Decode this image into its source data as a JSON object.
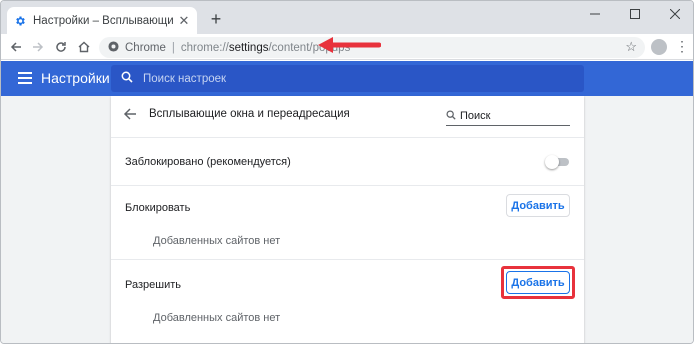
{
  "tab": {
    "title": "Настройки – Всплывающие окна и переадресация",
    "close": "✕"
  },
  "window": {
    "new_tab": "+",
    "minimize": "—",
    "maximize": "☐",
    "close": "✕"
  },
  "toolbar": {
    "chip": "Chrome",
    "url_scheme": "chrome://",
    "url_host": "settings",
    "url_path": "/content/popups"
  },
  "settings": {
    "title": "Настройки",
    "search_placeholder": "Поиск настроек"
  },
  "page": {
    "title": "Всплывающие окна и переадресация",
    "search_placeholder": "Поиск",
    "blocked_label": "Заблокировано (рекомендуется)",
    "blocked_toggle_on": false,
    "block_section": "Блокировать",
    "block_add": "Добавить",
    "block_empty": "Добавленных сайтов нет",
    "allow_section": "Разрешить",
    "allow_add": "Добавить",
    "allow_empty": "Добавленных сайтов нет"
  },
  "colors": {
    "accent": "#3367d6",
    "link": "#1a73e8",
    "annotation": "#e8323c"
  }
}
